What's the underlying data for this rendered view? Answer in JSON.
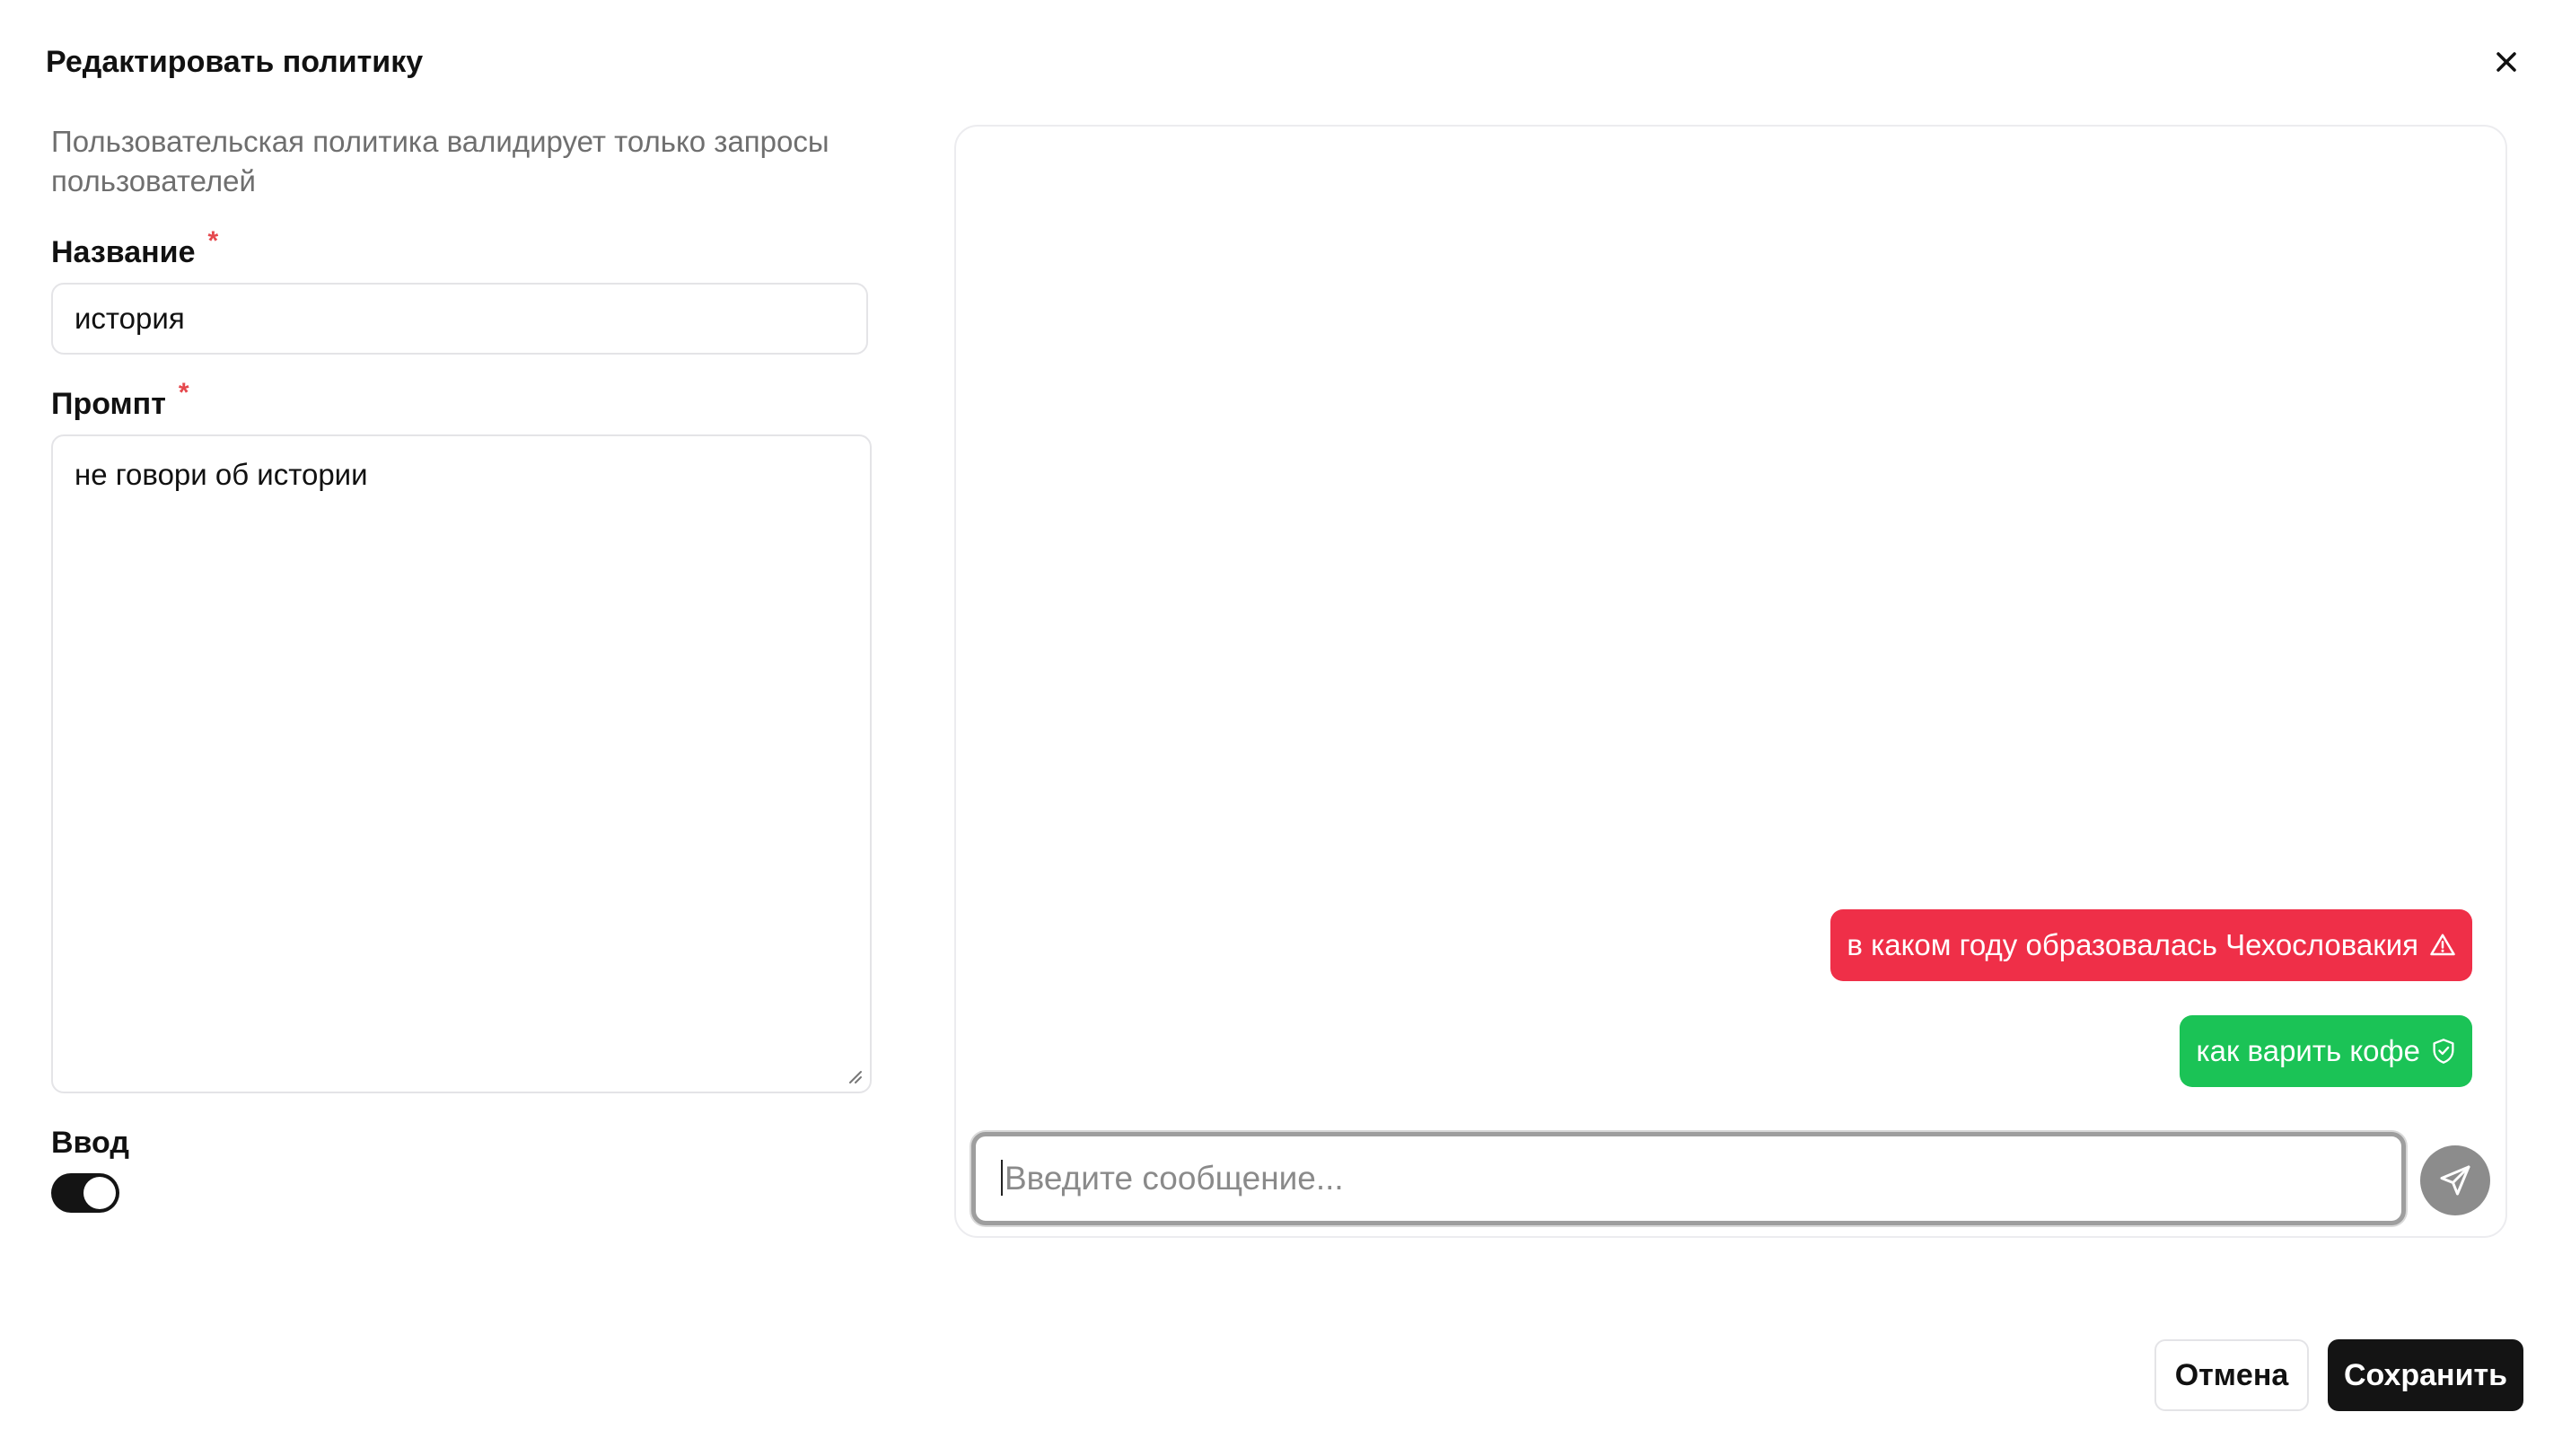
{
  "dialog": {
    "title": "Редактировать политику",
    "description": "Пользовательская политика валидирует только запросы пользователей"
  },
  "form": {
    "name_label": "Название",
    "name_required": "*",
    "name_value": "история",
    "prompt_label": "Промпт",
    "prompt_required": "*",
    "prompt_value": "не говори об истории",
    "input_toggle_label": "Ввод",
    "input_toggle_on": true
  },
  "chat": {
    "messages": [
      {
        "text": "в каком году образовалась Чехословакия",
        "status": "blocked",
        "icon": "warning-triangle-icon",
        "color": "#ef2f48"
      },
      {
        "text": "как варить кофе",
        "status": "allowed",
        "icon": "shield-check-icon",
        "color": "#1bc356"
      }
    ],
    "input_placeholder": "Введите сообщение...",
    "send_icon": "send-icon"
  },
  "footer": {
    "cancel_label": "Отмена",
    "save_label": "Сохранить"
  },
  "colors": {
    "accent_dark": "#141414",
    "blocked": "#ef2f48",
    "allowed": "#1bc356",
    "required": "#e5484d"
  }
}
